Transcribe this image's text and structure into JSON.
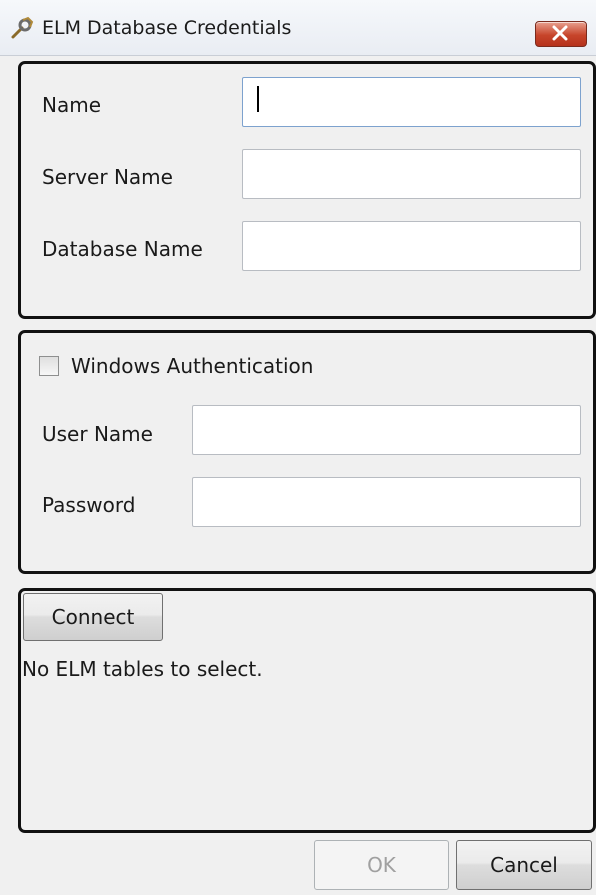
{
  "window": {
    "title": "ELM Database Credentials",
    "icon": "wrench-key-icon",
    "close_icon": "close-icon"
  },
  "database": {
    "name_label": "Name",
    "name_value": "",
    "server_label": "Server Name",
    "server_value": "",
    "database_label": "Database Name",
    "database_value": ""
  },
  "auth": {
    "windows_auth_label": "Windows Authentication",
    "windows_auth_checked": false,
    "username_label": "User Name",
    "username_value": "",
    "password_label": "Password",
    "password_value": ""
  },
  "connection": {
    "connect_label": "Connect",
    "status_message": "No ELM tables to select."
  },
  "footer": {
    "ok_label": "OK",
    "ok_enabled": false,
    "cancel_label": "Cancel"
  },
  "colors": {
    "close_button": "#c7452b",
    "group_border": "#111111",
    "focus_border": "#7da2ce"
  }
}
